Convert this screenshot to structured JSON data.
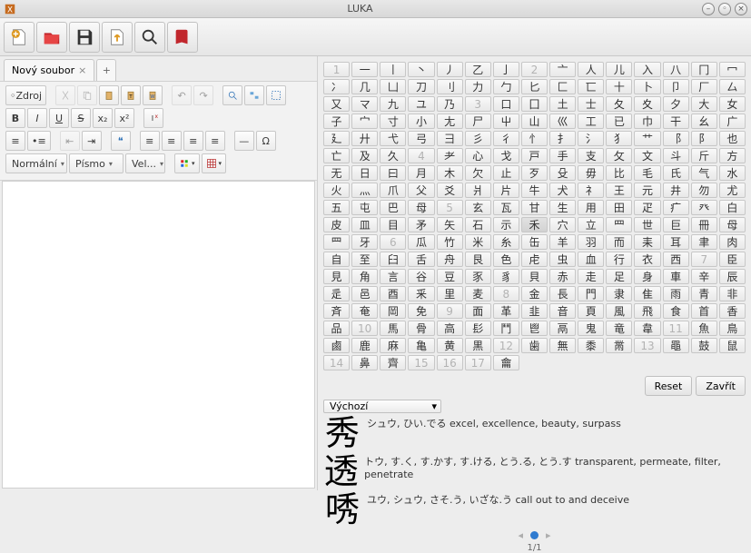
{
  "window": {
    "title": "LUKA"
  },
  "tabs": {
    "active": "Nový soubor",
    "addLabel": "+"
  },
  "editor": {
    "source_btn": "Zdroj",
    "format_dropdown": "Normální",
    "font_dropdown": "Písmo",
    "size_dropdown": "Vel...",
    "bold": "B",
    "italic": "I",
    "underline": "U",
    "strike": "S",
    "sub": "x₂",
    "sup": "x²"
  },
  "radical_grid": [
    "1",
    "一",
    "丨",
    "丶",
    "丿",
    "乙",
    "亅",
    "2",
    "亠",
    "人",
    "儿",
    "入",
    "八",
    "冂",
    "冖",
    "冫",
    "几",
    "凵",
    "刀",
    "刂",
    "力",
    "勹",
    "匕",
    "匚",
    "匸",
    "十",
    "卜",
    "卩",
    "厂",
    "厶",
    "又",
    "マ",
    "九",
    "ユ",
    "乃",
    "3",
    "口",
    "囗",
    "土",
    "士",
    "夂",
    "夊",
    "夕",
    "大",
    "女",
    "子",
    "宀",
    "寸",
    "小",
    "尢",
    "尸",
    "屮",
    "山",
    "巛",
    "工",
    "已",
    "巾",
    "干",
    "幺",
    "广",
    "廴",
    "廾",
    "弋",
    "弓",
    "彐",
    "彡",
    "彳",
    "⺖",
    "⺘",
    "⺡",
    "⺨",
    "⺾",
    "⻏",
    "⻖",
    "也",
    "亡",
    "及",
    "久",
    "4",
    "⺹",
    "心",
    "戈",
    "戸",
    "手",
    "支",
    "攵",
    "文",
    "斗",
    "斤",
    "方",
    "无",
    "日",
    "曰",
    "月",
    "木",
    "欠",
    "止",
    "歹",
    "殳",
    "毋",
    "比",
    "毛",
    "氏",
    "气",
    "水",
    "火",
    "⺣",
    "爪",
    "父",
    "爻",
    "爿",
    "片",
    "牛",
    "犬",
    "⺭",
    "王",
    "元",
    "井",
    "勿",
    "尤",
    "五",
    "屯",
    "巴",
    "母",
    "5",
    "玄",
    "瓦",
    "甘",
    "生",
    "用",
    "田",
    "疋",
    "疒",
    "癶",
    "白",
    "皮",
    "皿",
    "目",
    "矛",
    "矢",
    "石",
    "示",
    "禾",
    "穴",
    "立",
    "⺲",
    "世",
    "巨",
    "冊",
    "母",
    "⺫",
    "牙",
    "6",
    "瓜",
    "竹",
    "米",
    "糸",
    "缶",
    "羊",
    "羽",
    "而",
    "耒",
    "耳",
    "聿",
    "肉",
    "自",
    "至",
    "臼",
    "舌",
    "舟",
    "艮",
    "色",
    "虍",
    "虫",
    "血",
    "行",
    "衣",
    "西",
    "7",
    "臣",
    "見",
    "角",
    "言",
    "谷",
    "豆",
    "豕",
    "豸",
    "貝",
    "赤",
    "走",
    "足",
    "身",
    "車",
    "辛",
    "辰",
    "辵",
    "邑",
    "酉",
    "釆",
    "里",
    "麦",
    "8",
    "金",
    "長",
    "門",
    "隶",
    "隹",
    "雨",
    "青",
    "非",
    "斉",
    "奄",
    "岡",
    "免",
    "9",
    "面",
    "革",
    "韭",
    "音",
    "頁",
    "風",
    "飛",
    "食",
    "首",
    "香",
    "品",
    "10",
    "馬",
    "骨",
    "高",
    "髟",
    "鬥",
    "鬯",
    "鬲",
    "鬼",
    "竜",
    "韋",
    "11",
    "魚",
    "鳥",
    "鹵",
    "鹿",
    "麻",
    "亀",
    "黄",
    "黒",
    "12",
    "歯",
    "無",
    "黍",
    "黹",
    "13",
    "黽",
    "鼓",
    "鼠",
    "14",
    "鼻",
    "齊",
    "15",
    "16",
    "17",
    "龠",
    "",
    "",
    "",
    "",
    "",
    "",
    ""
  ],
  "selected_cell": "禾",
  "actions": {
    "reset": "Reset",
    "close": "Zavřít"
  },
  "results": {
    "sort_label": "Výchozí",
    "items": [
      {
        "kanji": "秀",
        "reading": "シュウ, ひい.でる",
        "meaning": "excel, excellence, beauty, surpass"
      },
      {
        "kanji": "透",
        "reading": "トウ, す.く, す.かす, す.ける, とう.る, とう.す",
        "meaning": "transparent, permeate, filter, penetrate"
      },
      {
        "kanji": "唀",
        "reading": "ユウ, シュウ, さそ.う, いざな.う",
        "meaning": "call out to and deceive"
      }
    ],
    "page_label": "1/1"
  }
}
